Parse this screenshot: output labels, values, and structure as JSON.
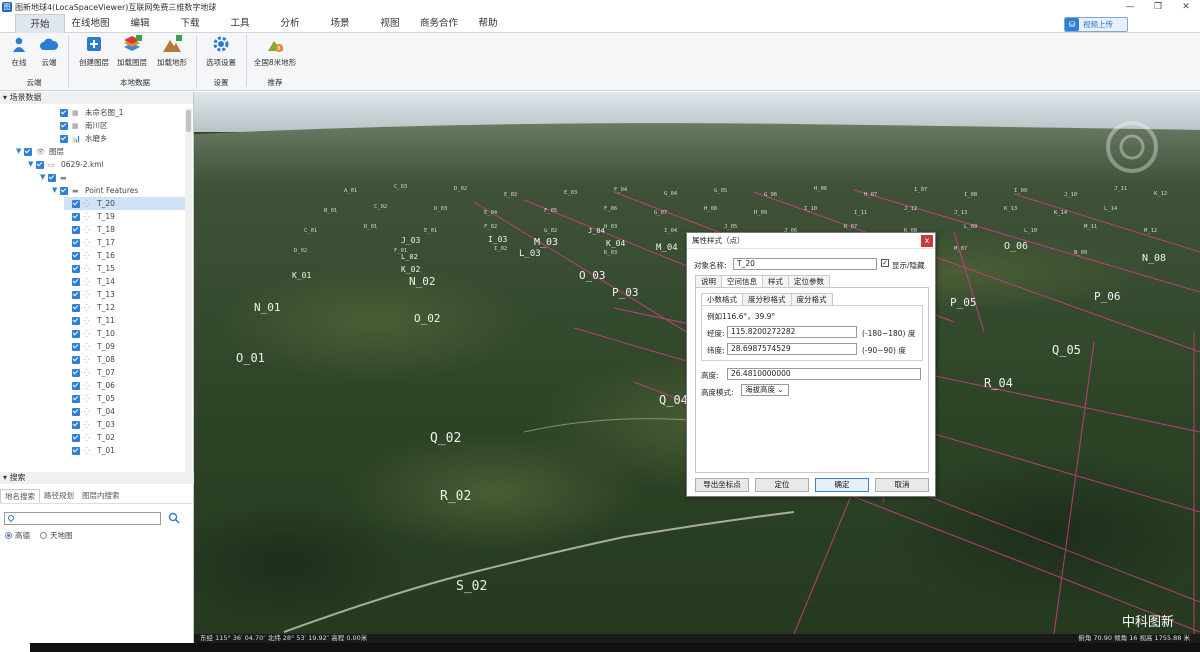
{
  "window": {
    "title": "图新地球4(LocaSpaceViewer)互联网免费三维数字地球",
    "controls": [
      "—",
      "❐",
      "✕"
    ]
  },
  "menu": {
    "tabs": [
      "开始",
      "在线地图",
      "编辑",
      "下载",
      "工具",
      "分析",
      "场景",
      "视图",
      "商务合作",
      "帮助"
    ],
    "active": "开始",
    "upload_label": "视频上传"
  },
  "ribbon": {
    "buttons": [
      {
        "label": "在线",
        "icon": "person-icon"
      },
      {
        "label": "云端",
        "icon": "cloud-icon"
      },
      {
        "label": "创建图层",
        "icon": "create-layer-icon"
      },
      {
        "label": "加载图层",
        "icon": "load-layer-icon"
      },
      {
        "label": "加载地形",
        "icon": "load-terrain-icon"
      },
      {
        "label": "选项设置",
        "icon": "gear-icon"
      },
      {
        "label": "全国8米地形",
        "icon": "terrain-8m-icon"
      }
    ],
    "groups": [
      "云端",
      "本地数据",
      "设置",
      "推荐"
    ]
  },
  "scene_panel": {
    "title": "场景数据",
    "items": [
      {
        "label": "未命名图_1",
        "indent": 4,
        "arrow": false,
        "glyph": "▦"
      },
      {
        "label": "南川区",
        "indent": 4,
        "arrow": false,
        "glyph": "▦"
      },
      {
        "label": "水磨乡",
        "indent": 4,
        "arrow": false,
        "glyph": "📊"
      },
      {
        "label": "图层",
        "indent": 1,
        "arrow": true,
        "glyph": "👁"
      },
      {
        "label": "0629-2.kml",
        "indent": 2,
        "arrow": true,
        "glyph": "▭"
      },
      {
        "label": "",
        "indent": 3,
        "arrow": true,
        "glyph": "▬"
      },
      {
        "label": "Point Features",
        "indent": 4,
        "arrow": true,
        "glyph": "▬"
      },
      {
        "label": "T_20",
        "indent": 5,
        "arrow": false,
        "glyph": "⁛",
        "selected": true
      },
      {
        "label": "T_19",
        "indent": 5,
        "arrow": false,
        "glyph": "⁛"
      },
      {
        "label": "T_18",
        "indent": 5,
        "arrow": false,
        "glyph": "⁛"
      },
      {
        "label": "T_17",
        "indent": 5,
        "arrow": false,
        "glyph": "⁛"
      },
      {
        "label": "T_16",
        "indent": 5,
        "arrow": false,
        "glyph": "⁛"
      },
      {
        "label": "T_15",
        "indent": 5,
        "arrow": false,
        "glyph": "⁛"
      },
      {
        "label": "T_14",
        "indent": 5,
        "arrow": false,
        "glyph": "⁛"
      },
      {
        "label": "T_13",
        "indent": 5,
        "arrow": false,
        "glyph": "⁛"
      },
      {
        "label": "T_12",
        "indent": 5,
        "arrow": false,
        "glyph": "⁛"
      },
      {
        "label": "T_11",
        "indent": 5,
        "arrow": false,
        "glyph": "⁛"
      },
      {
        "label": "T_10",
        "indent": 5,
        "arrow": false,
        "glyph": "⁛"
      },
      {
        "label": "T_09",
        "indent": 5,
        "arrow": false,
        "glyph": "⁛"
      },
      {
        "label": "T_08",
        "indent": 5,
        "arrow": false,
        "glyph": "⁛"
      },
      {
        "label": "T_07",
        "indent": 5,
        "arrow": false,
        "glyph": "⁛"
      },
      {
        "label": "T_06",
        "indent": 5,
        "arrow": false,
        "glyph": "⁛"
      },
      {
        "label": "T_05",
        "indent": 5,
        "arrow": false,
        "glyph": "⁛"
      },
      {
        "label": "T_04",
        "indent": 5,
        "arrow": false,
        "glyph": "⁛"
      },
      {
        "label": "T_03",
        "indent": 5,
        "arrow": false,
        "glyph": "⁛"
      },
      {
        "label": "T_02",
        "indent": 5,
        "arrow": false,
        "glyph": "⁛"
      },
      {
        "label": "T_01",
        "indent": 5,
        "arrow": false,
        "glyph": "⁛"
      }
    ]
  },
  "search_panel": {
    "title": "搜索",
    "tabs": [
      "地名搜索",
      "路径规划",
      "图层内搜索"
    ],
    "active_tab": "地名搜索",
    "input_value": "",
    "options": [
      "高德",
      "天地图"
    ],
    "selected_option": "高德"
  },
  "map": {
    "grid_labels": [
      "S_02",
      "R_02",
      "Q_02",
      "O_01",
      "N_01",
      "O_02",
      "N_02",
      "M_03",
      "L_03",
      "O_03",
      "P_03",
      "M_04",
      "K_04",
      "J_04",
      "Q_05",
      "R_04",
      "P_05",
      "P_06",
      "O_06",
      "N_08",
      "Q_04",
      "J_03",
      "K_02",
      "L_02",
      "K_01",
      "I_03"
    ],
    "watermark": "中科图新",
    "status_left": "东经 115° 36′ 04.70″  北纬 28° 53′ 19.92″  高程 0.00米",
    "status_right": "俯角 70.90  倾角 16  视高 1755.88 米"
  },
  "dialog": {
    "title": "属性样式（点）",
    "close_label": "x",
    "name_label": "对象名称:",
    "name_value": "T_20",
    "show_label": "显示/隐藏",
    "tabs": [
      "说明",
      "空间信息",
      "样式",
      "定位参数"
    ],
    "active_tab": "空间信息",
    "sub_tabs": [
      "小数格式",
      "度分秒格式",
      "度分格式"
    ],
    "active_sub_tab": "小数格式",
    "example": "例如116.6°，39.9°",
    "lon_label": "经度:",
    "lon_value": "115.8200272282",
    "lon_range": "(-180~180) 度",
    "lat_label": "纬度:",
    "lat_value": "28.6987574529",
    "lat_range": "(-90~90) 度",
    "alt_label": "高度:",
    "alt_value": "26.4810000000",
    "alt_mode_label": "高度模式:",
    "alt_mode_value": "海拔高度",
    "buttons": [
      "导出坐标点",
      "定位",
      "确定",
      "取消"
    ]
  }
}
